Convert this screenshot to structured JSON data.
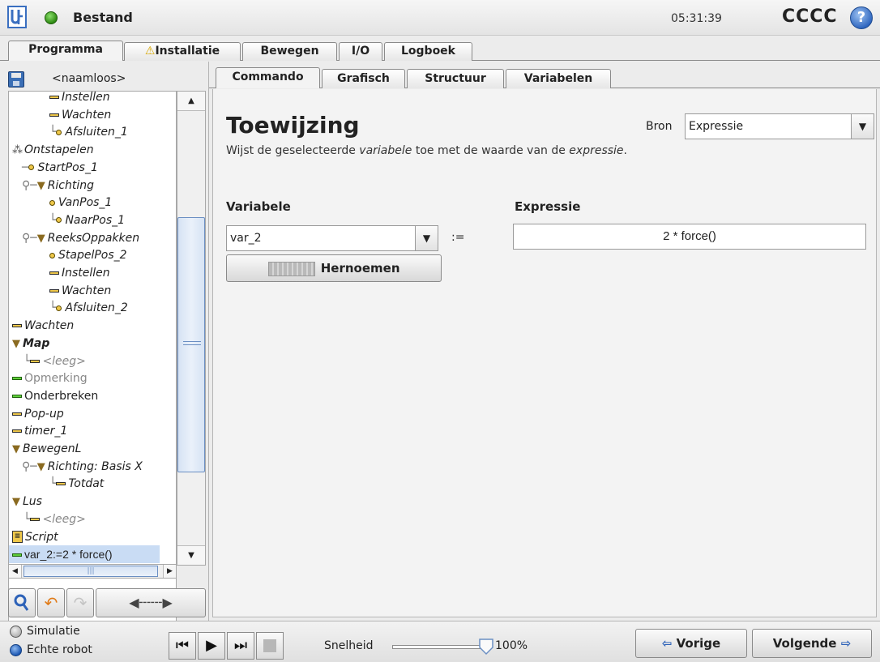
{
  "titlebar": {
    "title": "Bestand",
    "time": "05:31:39",
    "robot_name": "CCCC",
    "help_glyph": "?"
  },
  "main_tabs": [
    {
      "label": "Programma",
      "active": true
    },
    {
      "label": "Installatie",
      "warning": true
    },
    {
      "label": "Bewegen"
    },
    {
      "label": "I/O"
    },
    {
      "label": "Logboek"
    }
  ],
  "program": {
    "name": "<naamloos>"
  },
  "tree": [
    {
      "prefix": "",
      "icon": "dash",
      "label": "Instellen"
    },
    {
      "prefix": "",
      "icon": "dash",
      "label": "Wachten"
    },
    {
      "prefix": "",
      "icon": "dot",
      "label": "Afsluiten_1"
    },
    {
      "prefix": "",
      "icon": "stack",
      "label": "Ontstapelen"
    },
    {
      "prefix": "",
      "icon": "dot",
      "label": "StartPos_1"
    },
    {
      "prefix": "",
      "icon": "tri",
      "label": "Richting"
    },
    {
      "prefix": "",
      "icon": "dot",
      "label": "VanPos_1"
    },
    {
      "prefix": "",
      "icon": "dot",
      "label": "NaarPos_1"
    },
    {
      "prefix": "",
      "icon": "tri",
      "label": "ReeksOppakken"
    },
    {
      "prefix": "",
      "icon": "dot",
      "label": "StapelPos_2"
    },
    {
      "prefix": "",
      "icon": "dash",
      "label": "Instellen"
    },
    {
      "prefix": "",
      "icon": "dash",
      "label": "Wachten"
    },
    {
      "prefix": "",
      "icon": "dot",
      "label": "Afsluiten_2"
    },
    {
      "prefix": "",
      "icon": "dash",
      "label": "Wachten"
    },
    {
      "prefix": "",
      "icon": "tri",
      "label": "Map"
    },
    {
      "prefix": "",
      "icon": "dash",
      "label": "<leeg>"
    },
    {
      "prefix": "",
      "icon": "dash-green",
      "label": "Opmerking"
    },
    {
      "prefix": "",
      "icon": "dash-green",
      "label": "Onderbreken"
    },
    {
      "prefix": "",
      "icon": "dash",
      "label": "Pop-up"
    },
    {
      "prefix": "",
      "icon": "dash",
      "label": "timer_1"
    },
    {
      "prefix": "",
      "icon": "tri",
      "label": "BewegenL"
    },
    {
      "prefix": "",
      "icon": "tri",
      "label": "Richting: Basis X"
    },
    {
      "prefix": "",
      "icon": "dash",
      "label": "Totdat"
    },
    {
      "prefix": "",
      "icon": "tri",
      "label": "Lus"
    },
    {
      "prefix": "",
      "icon": "dash",
      "label": "<leeg>"
    },
    {
      "prefix": "",
      "icon": "script",
      "label": "Script"
    },
    {
      "prefix": "",
      "icon": "dash-green",
      "label": "var_2:=2 * force()"
    }
  ],
  "sub_tabs": [
    {
      "label": "Commando",
      "active": true
    },
    {
      "label": "Grafisch"
    },
    {
      "label": "Structuur"
    },
    {
      "label": "Variabelen"
    }
  ],
  "command": {
    "title": "Toewijzing",
    "desc_pre": "Wijst de geselecteerde ",
    "desc_var": "variabele",
    "desc_mid": " toe met de waarde van de ",
    "desc_expr": "expressie",
    "desc_post": ".",
    "bron_label": "Bron",
    "bron_value": "Expressie",
    "variabele_label": "Variabele",
    "variabele_value": "var_2",
    "assign_op": ":=",
    "expressie_label": "Expressie",
    "expressie_value": "2 * force()",
    "rename_label": "Hernoemen"
  },
  "bottom": {
    "simulatie_label": "Simulatie",
    "echte_robot_label": "Echte robot",
    "speed_label": "Snelheid",
    "speed_value": "100%",
    "speed_fraction": 1.0,
    "prev_label": "Vorige",
    "next_label": "Volgende"
  },
  "colors": {
    "accent_blue": "#2d62b8",
    "status_green": "#2e8a12",
    "selection": "#c9dcf4",
    "node_yellow": "#efc84a"
  }
}
